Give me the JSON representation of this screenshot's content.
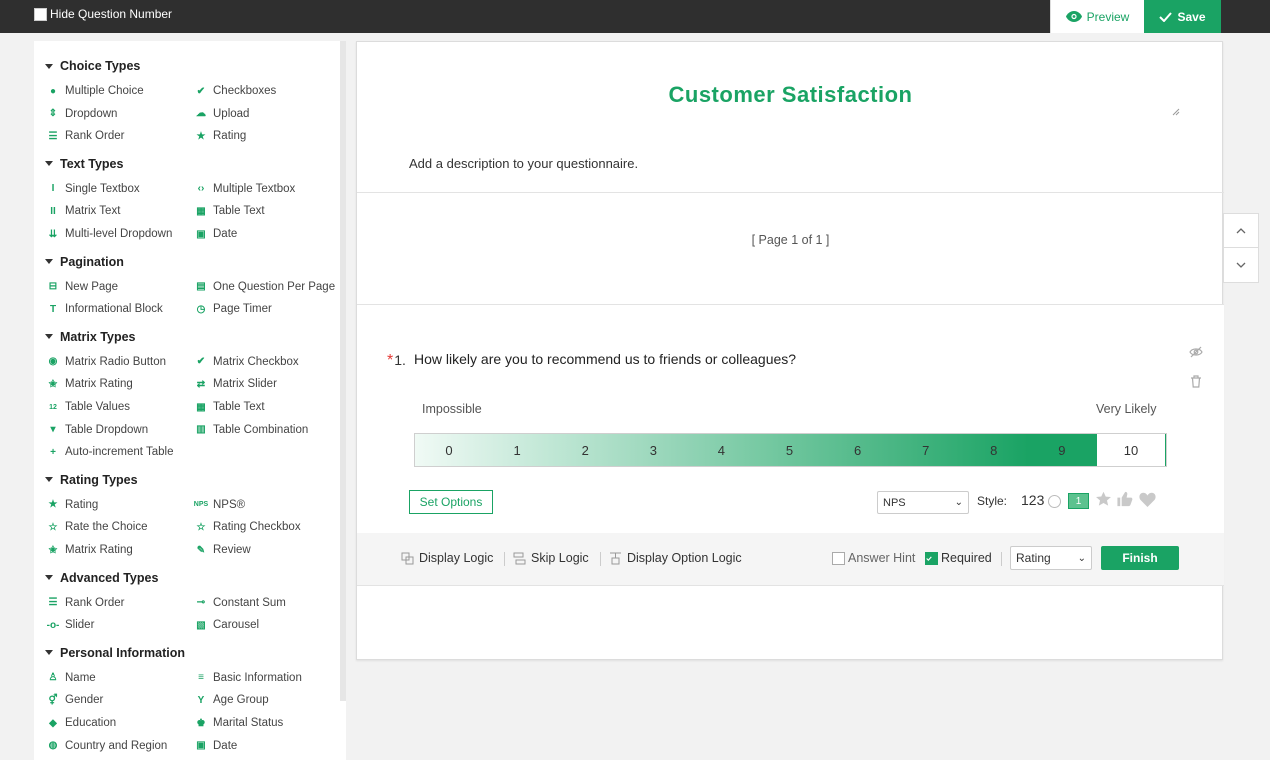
{
  "topbar": {
    "hide_question_number": "Hide Question Number",
    "preview": "Preview",
    "save": "Save"
  },
  "colors": {
    "accent": "#1aa364",
    "topbar": "#2f2f2f",
    "required_star": "#e53935"
  },
  "sidebar": {
    "sections": [
      {
        "title": "Choice Types",
        "items": [
          {
            "label": "Multiple Choice",
            "icon": "radio-dot-icon"
          },
          {
            "label": "Checkboxes",
            "icon": "check-icon"
          },
          {
            "label": "Dropdown",
            "icon": "dropdown-arrows-icon"
          },
          {
            "label": "Upload",
            "icon": "cloud-upload-icon"
          },
          {
            "label": "Rank Order",
            "icon": "list-icon"
          },
          {
            "label": "Rating",
            "icon": "star-icon"
          }
        ]
      },
      {
        "title": "Text Types",
        "items": [
          {
            "label": "Single Textbox",
            "icon": "text-cursor-icon"
          },
          {
            "label": "Multiple Textbox",
            "icon": "code-brackets-icon"
          },
          {
            "label": "Matrix Text",
            "icon": "double-cursor-icon"
          },
          {
            "label": "Table Text",
            "icon": "table-icon"
          },
          {
            "label": "Multi-level Dropdown",
            "icon": "cascade-icon"
          },
          {
            "label": "Date",
            "icon": "calendar-icon"
          }
        ]
      },
      {
        "title": "Pagination",
        "items": [
          {
            "label": "New Page",
            "icon": "page-break-icon"
          },
          {
            "label": "One Question Per Page",
            "icon": "page-icon"
          },
          {
            "label": "Informational Block",
            "icon": "text-t-icon"
          },
          {
            "label": "Page Timer",
            "icon": "timer-icon"
          }
        ]
      },
      {
        "title": "Matrix Types",
        "items": [
          {
            "label": "Matrix Radio Button",
            "icon": "matrix-radio-icon"
          },
          {
            "label": "Matrix Checkbox",
            "icon": "check-icon"
          },
          {
            "label": "Matrix Rating",
            "icon": "stars-icon"
          },
          {
            "label": "Matrix Slider",
            "icon": "slider-arrows-icon"
          },
          {
            "label": "Table Values",
            "icon": "numbers-12-icon"
          },
          {
            "label": "Table Text",
            "icon": "table-icon"
          },
          {
            "label": "Table Dropdown",
            "icon": "dropdown-box-icon"
          },
          {
            "label": "Table Combination",
            "icon": "table-combo-icon"
          },
          {
            "label": "Auto-increment Table",
            "icon": "plus-icon"
          }
        ]
      },
      {
        "title": "Rating Types",
        "items": [
          {
            "label": "Rating",
            "icon": "star-icon"
          },
          {
            "label": "NPS®",
            "icon": "nps-icon"
          },
          {
            "label": "Rate the Choice",
            "icon": "star-outline-icon"
          },
          {
            "label": "Rating Checkbox",
            "icon": "star-outline-icon"
          },
          {
            "label": "Matrix Rating",
            "icon": "stars-icon"
          },
          {
            "label": "Review",
            "icon": "pencil-icon"
          }
        ]
      },
      {
        "title": "Advanced Types",
        "items": [
          {
            "label": "Rank Order",
            "icon": "list-icon"
          },
          {
            "label": "Constant Sum",
            "icon": "constant-sum-icon"
          },
          {
            "label": "Slider",
            "icon": "slider-icon"
          },
          {
            "label": "Carousel",
            "icon": "carousel-icon"
          }
        ]
      },
      {
        "title": "Personal Information",
        "items": [
          {
            "label": "Name",
            "icon": "person-icon"
          },
          {
            "label": "Basic Information",
            "icon": "id-card-icon"
          },
          {
            "label": "Gender",
            "icon": "gender-icon"
          },
          {
            "label": "Age Group",
            "icon": "age-icon"
          },
          {
            "label": "Education",
            "icon": "graduation-icon"
          },
          {
            "label": "Marital Status",
            "icon": "couple-icon"
          },
          {
            "label": "Country and Region",
            "icon": "globe-icon"
          },
          {
            "label": "Date",
            "icon": "calendar-icon"
          }
        ]
      }
    ]
  },
  "survey": {
    "title": "Customer Satisfaction",
    "description": "Add a description to your questionnaire.",
    "page_info": "[ Page 1 of 1 ]"
  },
  "question": {
    "required_mark": "*",
    "number": "1.",
    "text": "How likely are you to recommend us to friends or colleagues?",
    "label_left": "Impossible",
    "label_right": "Very Likely",
    "scale": [
      "0",
      "1",
      "2",
      "3",
      "4",
      "5",
      "6",
      "7",
      "8",
      "9",
      "10"
    ],
    "selected_value": 10,
    "set_options": "Set Options",
    "type_select": "NPS",
    "style_label": "Style:",
    "style_123": "123",
    "style_box_digit": "1"
  },
  "toolbar": {
    "display_logic": "Display Logic",
    "skip_logic": "Skip Logic",
    "display_option_logic": "Display Option Logic",
    "answer_hint": "Answer Hint",
    "answer_hint_checked": false,
    "required": "Required",
    "required_checked": true,
    "question_type": "Rating",
    "finish": "Finish"
  }
}
